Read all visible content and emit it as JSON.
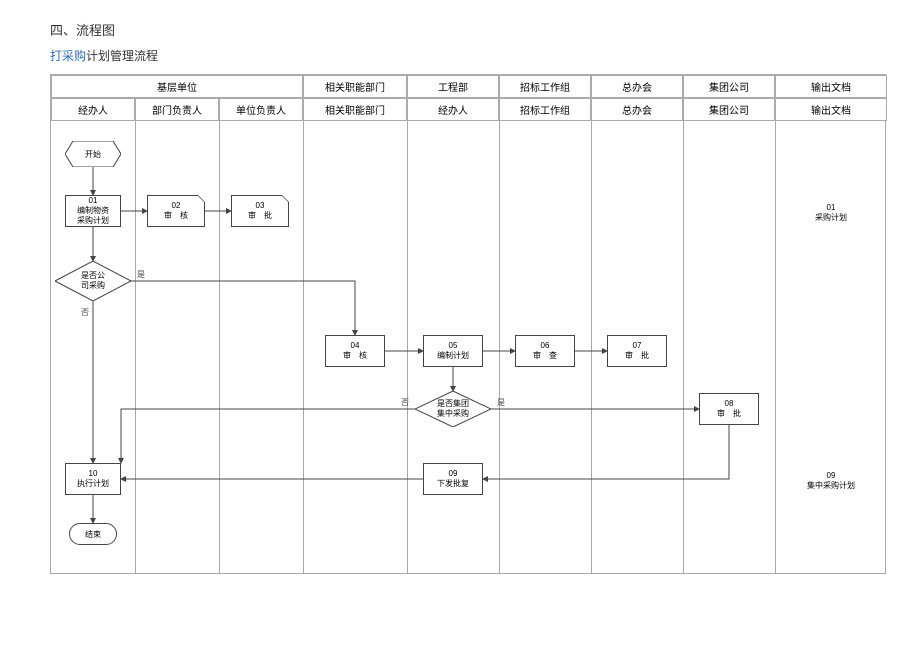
{
  "heading": "四、流程图",
  "subtitle_link": "打采购",
  "subtitle_rest": "计划管理流程",
  "lanes": {
    "l1": "基层单位",
    "l1a": "经办人",
    "l1b": "部门负责人",
    "l1c": "单位负责人",
    "l2": "相关职能部门",
    "l2a": "相关职能部门",
    "l3": "工程部",
    "l3a": "经办人",
    "l4": "招标工作组",
    "l4a": "招标工作组",
    "l5": "总办会",
    "l5a": "总办会",
    "l6": "集团公司",
    "l6a": "集团公司",
    "l7": "输出文档",
    "l7a": "输出文档"
  },
  "nodes": {
    "start": "开始",
    "end": "结束",
    "n01_num": "01",
    "n01_text": "编制物资\n采购计划",
    "n02_num": "02",
    "n02_text": "审　核",
    "n03_num": "03",
    "n03_text": "审　批",
    "d1_text": "是否公\n司采购",
    "n04_num": "04",
    "n04_text": "审　核",
    "n05_num": "05",
    "n05_text": "编制计划",
    "n06_num": "06",
    "n06_text": "审　查",
    "n07_num": "07",
    "n07_text": "审　批",
    "d2_text": "是否集团\n集中采购",
    "n08_num": "08",
    "n08_text": "审　批",
    "n09_num": "09",
    "n09_text": "下发批复",
    "n10_num": "10",
    "n10_text": "执行计划",
    "doc01_num": "01",
    "doc01_text": "采购计划",
    "doc09_num": "09",
    "doc09_text": "集中采购计划"
  },
  "labels": {
    "yes": "是",
    "no": "否"
  }
}
